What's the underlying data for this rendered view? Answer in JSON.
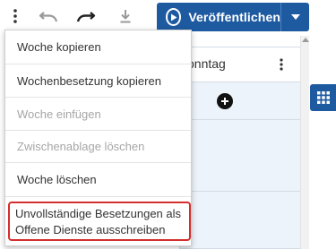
{
  "toolbar": {
    "icons": {
      "more": "more-vertical-icon",
      "undo": "undo-icon",
      "redo": "redo-icon",
      "download": "download-icon"
    },
    "publish_label": "Veröffentlichen",
    "publish_color": "#1e5aa0"
  },
  "grid": {
    "column_title": "onntag"
  },
  "menu": {
    "items": [
      {
        "label": "Woche kopieren",
        "enabled": true
      },
      {
        "label": "Wochenbesetzung kopieren",
        "enabled": true
      },
      {
        "label": "Woche einfügen",
        "enabled": false
      },
      {
        "label": "Zwischenablage löschen",
        "enabled": false
      },
      {
        "label": "Woche löschen",
        "enabled": true
      },
      {
        "label_line1": "Unvollständige Besetzungen als",
        "label_line2": "Offene Dienste ausschreiben",
        "enabled": true,
        "highlighted": true
      }
    ],
    "highlight_color": "#d32f2f"
  }
}
